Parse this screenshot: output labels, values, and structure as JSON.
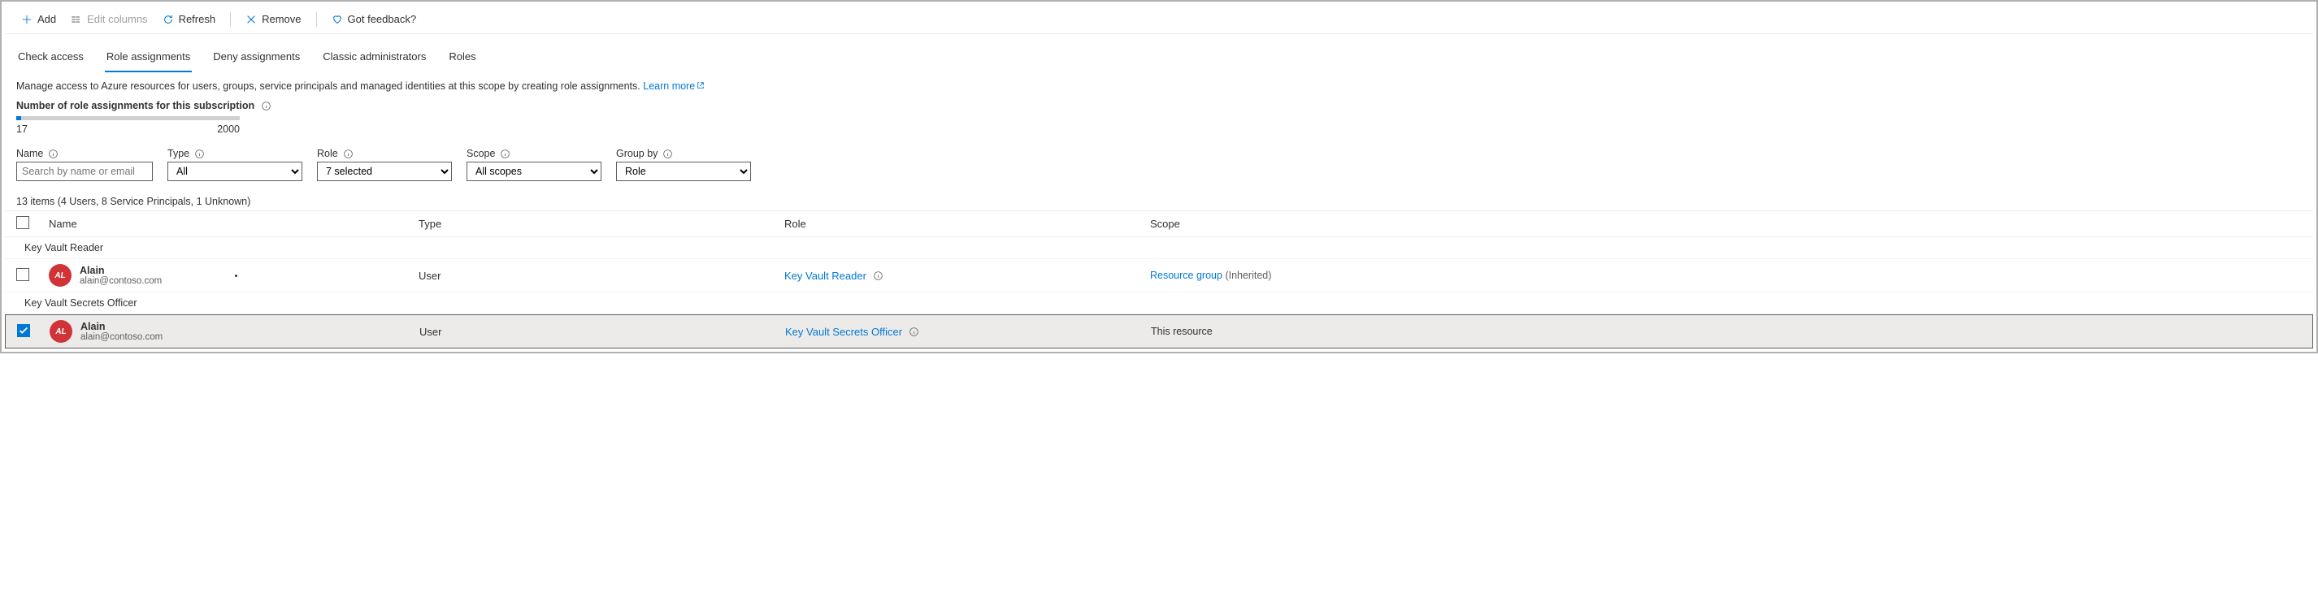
{
  "toolbar": {
    "add": "Add",
    "edit_columns": "Edit columns",
    "refresh": "Refresh",
    "remove": "Remove",
    "feedback": "Got feedback?"
  },
  "tabs": {
    "check_access": "Check access",
    "role_assignments": "Role assignments",
    "deny_assignments": "Deny assignments",
    "classic_admins": "Classic administrators",
    "roles": "Roles"
  },
  "description": "Manage access to Azure resources for users, groups, service principals and managed identities at this scope by creating role assignments.",
  "learn_more": "Learn more",
  "quota": {
    "label": "Number of role assignments for this subscription",
    "current": "17",
    "max": "2000"
  },
  "filters": {
    "name": {
      "label": "Name",
      "placeholder": "Search by name or email"
    },
    "type": {
      "label": "Type",
      "value": "All"
    },
    "role": {
      "label": "Role",
      "value": "7 selected"
    },
    "scope": {
      "label": "Scope",
      "value": "All scopes"
    },
    "group_by": {
      "label": "Group by",
      "value": "Role"
    }
  },
  "summary": "13 items (4 Users, 8 Service Principals, 1 Unknown)",
  "columns": {
    "name": "Name",
    "type": "Type",
    "role": "Role",
    "scope": "Scope"
  },
  "groups": [
    {
      "title": "Key Vault Reader",
      "rows": [
        {
          "initials": "AL",
          "name": "Alain",
          "email": "alain@contoso.com",
          "type": "User",
          "role": "Key Vault Reader",
          "scope_link": "Resource group",
          "scope_suffix": "(Inherited)",
          "selected": false,
          "has_dot": true
        }
      ]
    },
    {
      "title": "Key Vault Secrets Officer",
      "rows": [
        {
          "initials": "AL",
          "name": "Alain",
          "email": "alain@contoso.com",
          "type": "User",
          "role": "Key Vault Secrets Officer",
          "scope_text": "This resource",
          "selected": true,
          "has_dot": false
        }
      ]
    }
  ]
}
